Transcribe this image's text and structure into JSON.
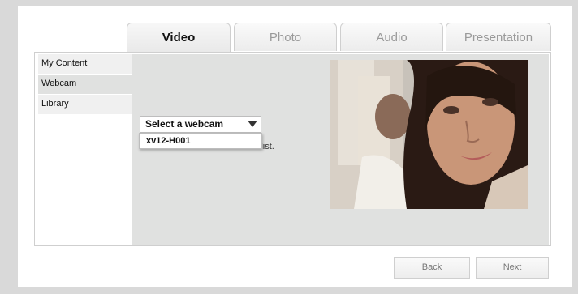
{
  "tabs": [
    {
      "label": "Video",
      "active": true
    },
    {
      "label": "Photo",
      "active": false
    },
    {
      "label": "Audio",
      "active": false
    },
    {
      "label": "Presentation",
      "active": false
    }
  ],
  "sidebar": {
    "items": [
      {
        "label": "My Content",
        "active": false
      },
      {
        "label": "Webcam",
        "active": true
      },
      {
        "label": "Library",
        "active": false
      }
    ]
  },
  "webcam": {
    "select_label": "Select a webcam",
    "options": [
      "xv12-H001"
    ],
    "hint_fragment": "the list."
  },
  "preview": {
    "icon": "webcam-video-feed"
  },
  "footer": {
    "back_label": "Back",
    "next_label": "Next"
  },
  "colors": {
    "background": "#d9d9d9",
    "panel": "#ffffff",
    "content_area": "#e0e1e0",
    "active_tab_text": "#111111",
    "inactive_tab_text": "#9a9a9a"
  }
}
